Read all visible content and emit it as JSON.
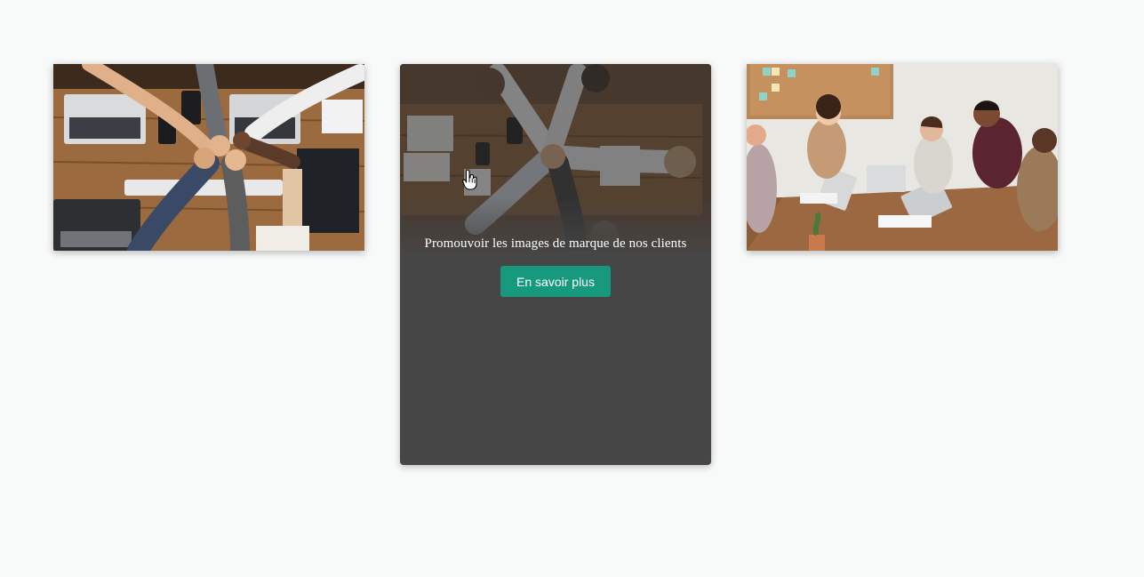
{
  "cards": [
    {
      "image": "team-fist-bump-photo"
    },
    {
      "image": "team-hands-stacked-photo",
      "caption": "Promouvoir les images de marque de nos clients",
      "button_label": "En savoir plus"
    },
    {
      "image": "team-meeting-photo"
    }
  ],
  "colors": {
    "page_background": "#f8f9f9",
    "card_overlay": "#464646",
    "button": "#17997d",
    "button_text": "#ffffff",
    "caption_text": "#ffffff"
  },
  "icons": {
    "cursor": "hand-pointer-icon"
  }
}
